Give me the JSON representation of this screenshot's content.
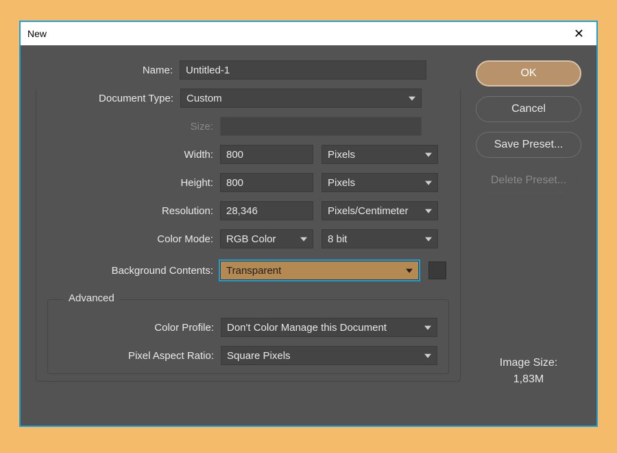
{
  "titlebar": {
    "title": "New"
  },
  "form": {
    "name_label": "Name:",
    "name_value": "Untitled-1",
    "doc_type_label": "Document Type:",
    "doc_type_value": "Custom",
    "size_label": "Size:",
    "size_value": "",
    "width_label": "Width:",
    "width_value": "800",
    "width_unit": "Pixels",
    "height_label": "Height:",
    "height_value": "800",
    "height_unit": "Pixels",
    "resolution_label": "Resolution:",
    "resolution_value": "28,346",
    "resolution_unit": "Pixels/Centimeter",
    "color_mode_label": "Color Mode:",
    "color_mode_value": "RGB Color",
    "color_depth_value": "8 bit",
    "bg_contents_label": "Background Contents:",
    "bg_contents_value": "Transparent"
  },
  "advanced": {
    "legend": "Advanced",
    "color_profile_label": "Color Profile:",
    "color_profile_value": "Don't Color Manage this Document",
    "pixel_aspect_label": "Pixel Aspect Ratio:",
    "pixel_aspect_value": "Square Pixels"
  },
  "buttons": {
    "ok": "OK",
    "cancel": "Cancel",
    "save_preset": "Save Preset...",
    "delete_preset": "Delete Preset..."
  },
  "image_size": {
    "label": "Image Size:",
    "value": "1,83M"
  }
}
